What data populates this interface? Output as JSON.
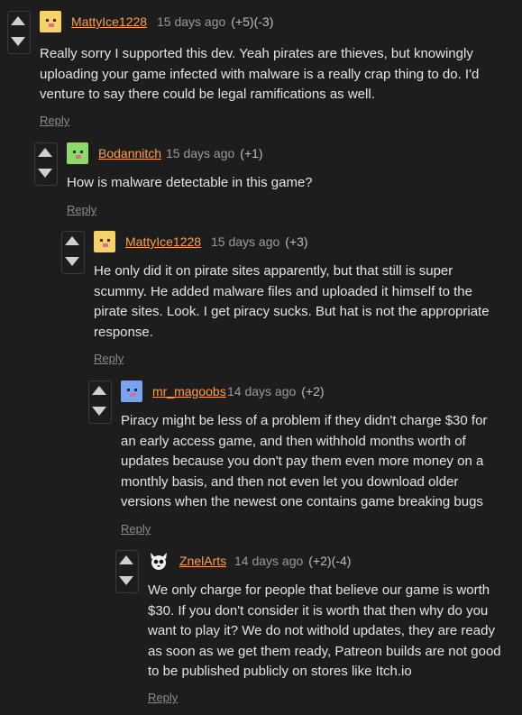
{
  "comments": [
    {
      "author": "MattyIce1228",
      "time": "15 days ago",
      "score": "(+5)(-3)",
      "lines": [
        "Really sorry I supported this dev. Yeah pirates are thieves, but knowingly",
        "uploading your game infected with malware is a really crap thing to do. I'd",
        "venture to say there could be legal ramifications as well."
      ],
      "reply": "Reply",
      "avatar_color": "#f6d36a"
    },
    {
      "author": "Bodannitch",
      "time": "15 days ago",
      "score": "(+1)",
      "lines": [
        "How is malware detectable in this game?"
      ],
      "reply": "Reply",
      "avatar_color": "#8fd96b"
    },
    {
      "author": "MattyIce1228",
      "time": "15 days ago",
      "score": "(+3)",
      "lines": [
        "He only did it on pirate sites apparently, but that still is super",
        "scummy. He added malware files and uploaded it himself to the",
        "pirate sites. Look. I get piracy sucks. But hat is not the appropriate",
        "response."
      ],
      "reply": "Reply",
      "avatar_color": "#f6d36a"
    },
    {
      "author": "mr_magoobs",
      "time": "14 days ago",
      "score": "(+2)",
      "lines": [
        "Piracy might be less of a problem if they didn't charge $30 for",
        "an early access game, and then withhold months worth of",
        "updates because you don't pay them even more money on a",
        "monthly basis, and then not even let you download older",
        "versions when the newest one contains game breaking bugs"
      ],
      "reply": "Reply",
      "avatar_color": "#7aa3ee"
    },
    {
      "author": "ZnelArts",
      "time": "14 days ago",
      "score": "(+2)(-4)",
      "lines": [
        "We only charge for people that believe our game is worth",
        "$30. If you don't consider it is worth that then why do you",
        "want to play it? We do not withold updates, they are ready",
        "as soon as we get them ready, Patreon builds are not good",
        "to be published publicly on stores like Itch.io"
      ],
      "reply": "Reply",
      "avatar_color": "#1d1d1d"
    }
  ]
}
